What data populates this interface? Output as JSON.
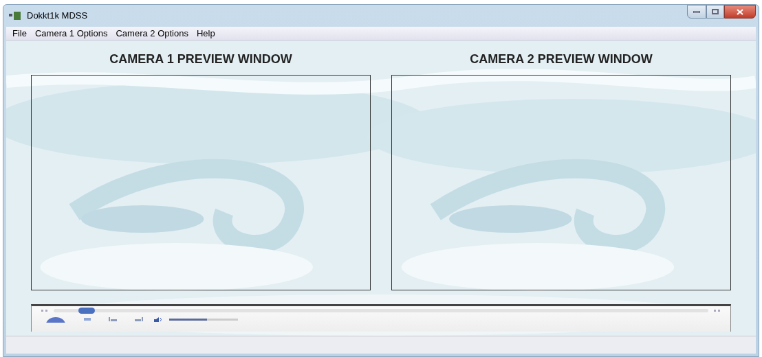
{
  "window": {
    "title": "Dokkt1k MDSS"
  },
  "menu": [
    {
      "label": "File"
    },
    {
      "label": "Camera 1 Options"
    },
    {
      "label": "Camera 2 Options"
    },
    {
      "label": "Help"
    }
  ],
  "previews": [
    {
      "heading": "CAMERA 1 PREVIEW WINDOW"
    },
    {
      "heading": "CAMERA 2 PREVIEW WINDOW"
    }
  ],
  "player": {
    "seek": {
      "level": 0.05
    },
    "volume": {
      "level": 0.55
    }
  }
}
